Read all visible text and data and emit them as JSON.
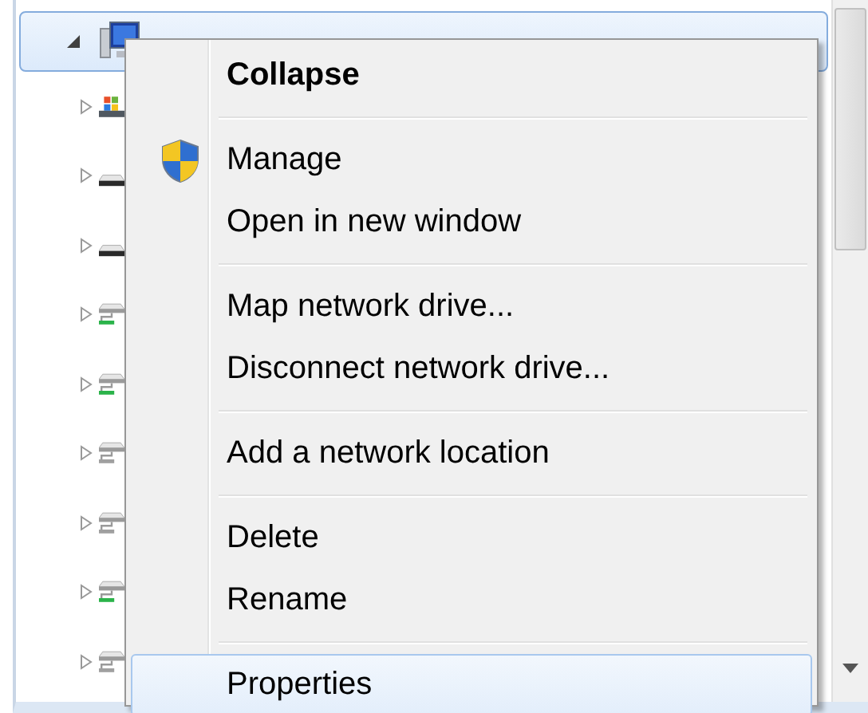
{
  "tree": {
    "root": {
      "expanded": true,
      "selected": true,
      "children": [
        {
          "kind": "windows-drive",
          "expanded": false
        },
        {
          "kind": "drive",
          "expanded": false
        },
        {
          "kind": "drive",
          "expanded": false
        },
        {
          "kind": "network-drive",
          "connected": true,
          "expanded": false
        },
        {
          "kind": "network-drive",
          "connected": true,
          "expanded": false
        },
        {
          "kind": "network-drive",
          "connected": false,
          "expanded": false
        },
        {
          "kind": "network-drive",
          "connected": false,
          "expanded": false
        },
        {
          "kind": "network-drive",
          "connected": true,
          "expanded": false
        },
        {
          "kind": "network-drive",
          "connected": false,
          "expanded": false
        }
      ]
    }
  },
  "context_menu": {
    "items": [
      {
        "kind": "item",
        "label": "Collapse",
        "default": true,
        "selected": false
      },
      {
        "kind": "separator"
      },
      {
        "kind": "elevated",
        "label": "Manage",
        "default": false,
        "selected": false
      },
      {
        "kind": "item",
        "label": "Open in new window",
        "default": false,
        "selected": false
      },
      {
        "kind": "separator"
      },
      {
        "kind": "item",
        "label": "Map network drive...",
        "default": false,
        "selected": false
      },
      {
        "kind": "item",
        "label": "Disconnect network drive...",
        "default": false,
        "selected": false
      },
      {
        "kind": "separator"
      },
      {
        "kind": "item",
        "label": "Add a network location",
        "default": false,
        "selected": false
      },
      {
        "kind": "separator"
      },
      {
        "kind": "item",
        "label": "Delete",
        "default": false,
        "selected": false
      },
      {
        "kind": "item",
        "label": "Rename",
        "default": false,
        "selected": false
      },
      {
        "kind": "separator"
      },
      {
        "kind": "item",
        "label": "Properties",
        "default": false,
        "selected": true
      }
    ]
  }
}
